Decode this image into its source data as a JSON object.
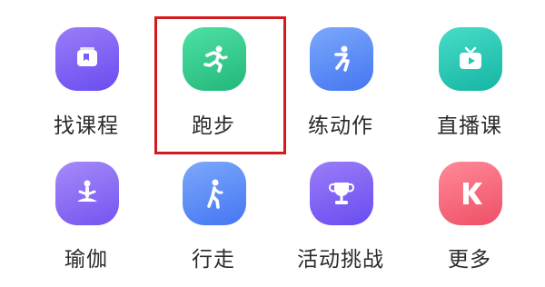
{
  "tiles": [
    {
      "label": "找课程",
      "icon": "course-book-icon",
      "color": "#7a5cf2"
    },
    {
      "label": "跑步",
      "icon": "running-person-icon",
      "color": "#2fc98a"
    },
    {
      "label": "练动作",
      "icon": "stretch-pose-icon",
      "color": "#5a8ef8"
    },
    {
      "label": "直播课",
      "icon": "tv-play-icon",
      "color": "#22c9b6"
    },
    {
      "label": "瑜伽",
      "icon": "meditation-person-icon",
      "color": "#8a6af5"
    },
    {
      "label": "行走",
      "icon": "walking-person-icon",
      "color": "#5a8ef8"
    },
    {
      "label": "活动挑战",
      "icon": "trophy-icon",
      "color": "#7d62f2"
    },
    {
      "label": "更多",
      "icon": "k-logo-icon",
      "color": "#f56b7d"
    }
  ],
  "selected_tile": "跑步",
  "highlight_color": "#d4191c"
}
